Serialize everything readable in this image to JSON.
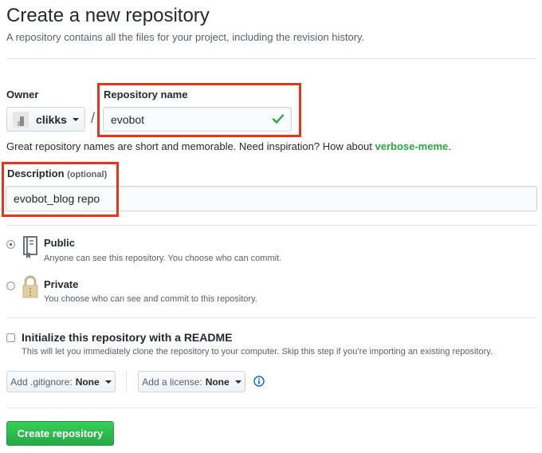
{
  "header": {
    "title": "Create a new repository",
    "subtitle": "A repository contains all the files for your project, including the revision history."
  },
  "owner": {
    "label": "Owner",
    "value": "clikks",
    "separator": "/"
  },
  "repo_name": {
    "label": "Repository name",
    "value": "evobot",
    "valid": true
  },
  "hint": {
    "text": "Great repository names are short and memorable. Need inspiration? How about",
    "suggestion": "verbose-meme",
    "end": "."
  },
  "description": {
    "label": "Description",
    "optional": "(optional)",
    "value": "evobot_blog repo"
  },
  "visibility": {
    "public": {
      "title": "Public",
      "note": "Anyone can see this repository. You choose who can commit.",
      "selected": true
    },
    "private": {
      "title": "Private",
      "note": "You choose who can see and commit to this repository.",
      "selected": false
    }
  },
  "readme": {
    "title": "Initialize this repository with a README",
    "note": "This will let you immediately clone the repository to your computer. Skip this step if you’re importing an existing repository.",
    "checked": false
  },
  "gitignore": {
    "prefix": "Add .gitignore:",
    "value": "None"
  },
  "license": {
    "prefix": "Add a license:",
    "value": "None"
  },
  "submit": {
    "label": "Create repository"
  },
  "colors": {
    "accent_green": "#28a745",
    "highlight_red": "#e8341c",
    "info_blue": "#0366d6"
  }
}
